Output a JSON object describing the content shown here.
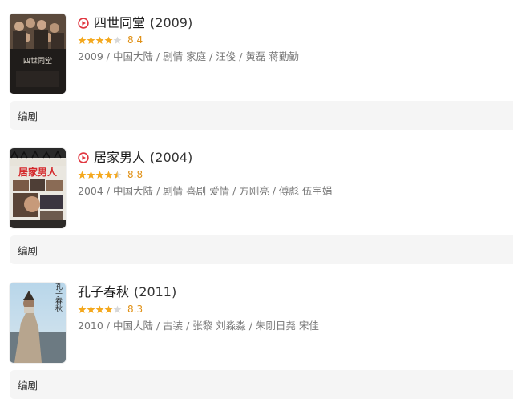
{
  "colors": {
    "star_filled": "#f4a81d",
    "star_empty": "#d8d8d8",
    "rating_text": "#e09015",
    "play_icon": "#e0353f",
    "role_bar_bg": "#f5f5f5"
  },
  "movies": [
    {
      "title": "四世同堂",
      "year": "(2009)",
      "has_play_icon": true,
      "play_icon": "play-circle-icon",
      "rating": "8.4",
      "stars_filled": 4,
      "meta": "2009 / 中国大陆 / 剧情 家庭 / 汪俊 / 黄磊 蒋勤勤",
      "role": "编剧",
      "poster_text": "四世同堂"
    },
    {
      "title": "居家男人",
      "year": "(2004)",
      "has_play_icon": true,
      "play_icon": "play-circle-icon",
      "rating": "8.8",
      "stars_filled": 4.5,
      "meta": "2004 / 中国大陆 / 剧情 喜剧 爱情 / 方刚亮 / 傅彪 伍宇娟",
      "role": "编剧",
      "poster_text": "居家男人"
    },
    {
      "title": "孔子春秋",
      "year": "(2011)",
      "has_play_icon": false,
      "rating": "8.3",
      "stars_filled": 4,
      "meta": "2010 / 中国大陆 / 古装 / 张黎 刘淼淼 / 朱刚日尧 宋佳",
      "role": "编剧",
      "poster_text": "孔子春秋"
    }
  ]
}
